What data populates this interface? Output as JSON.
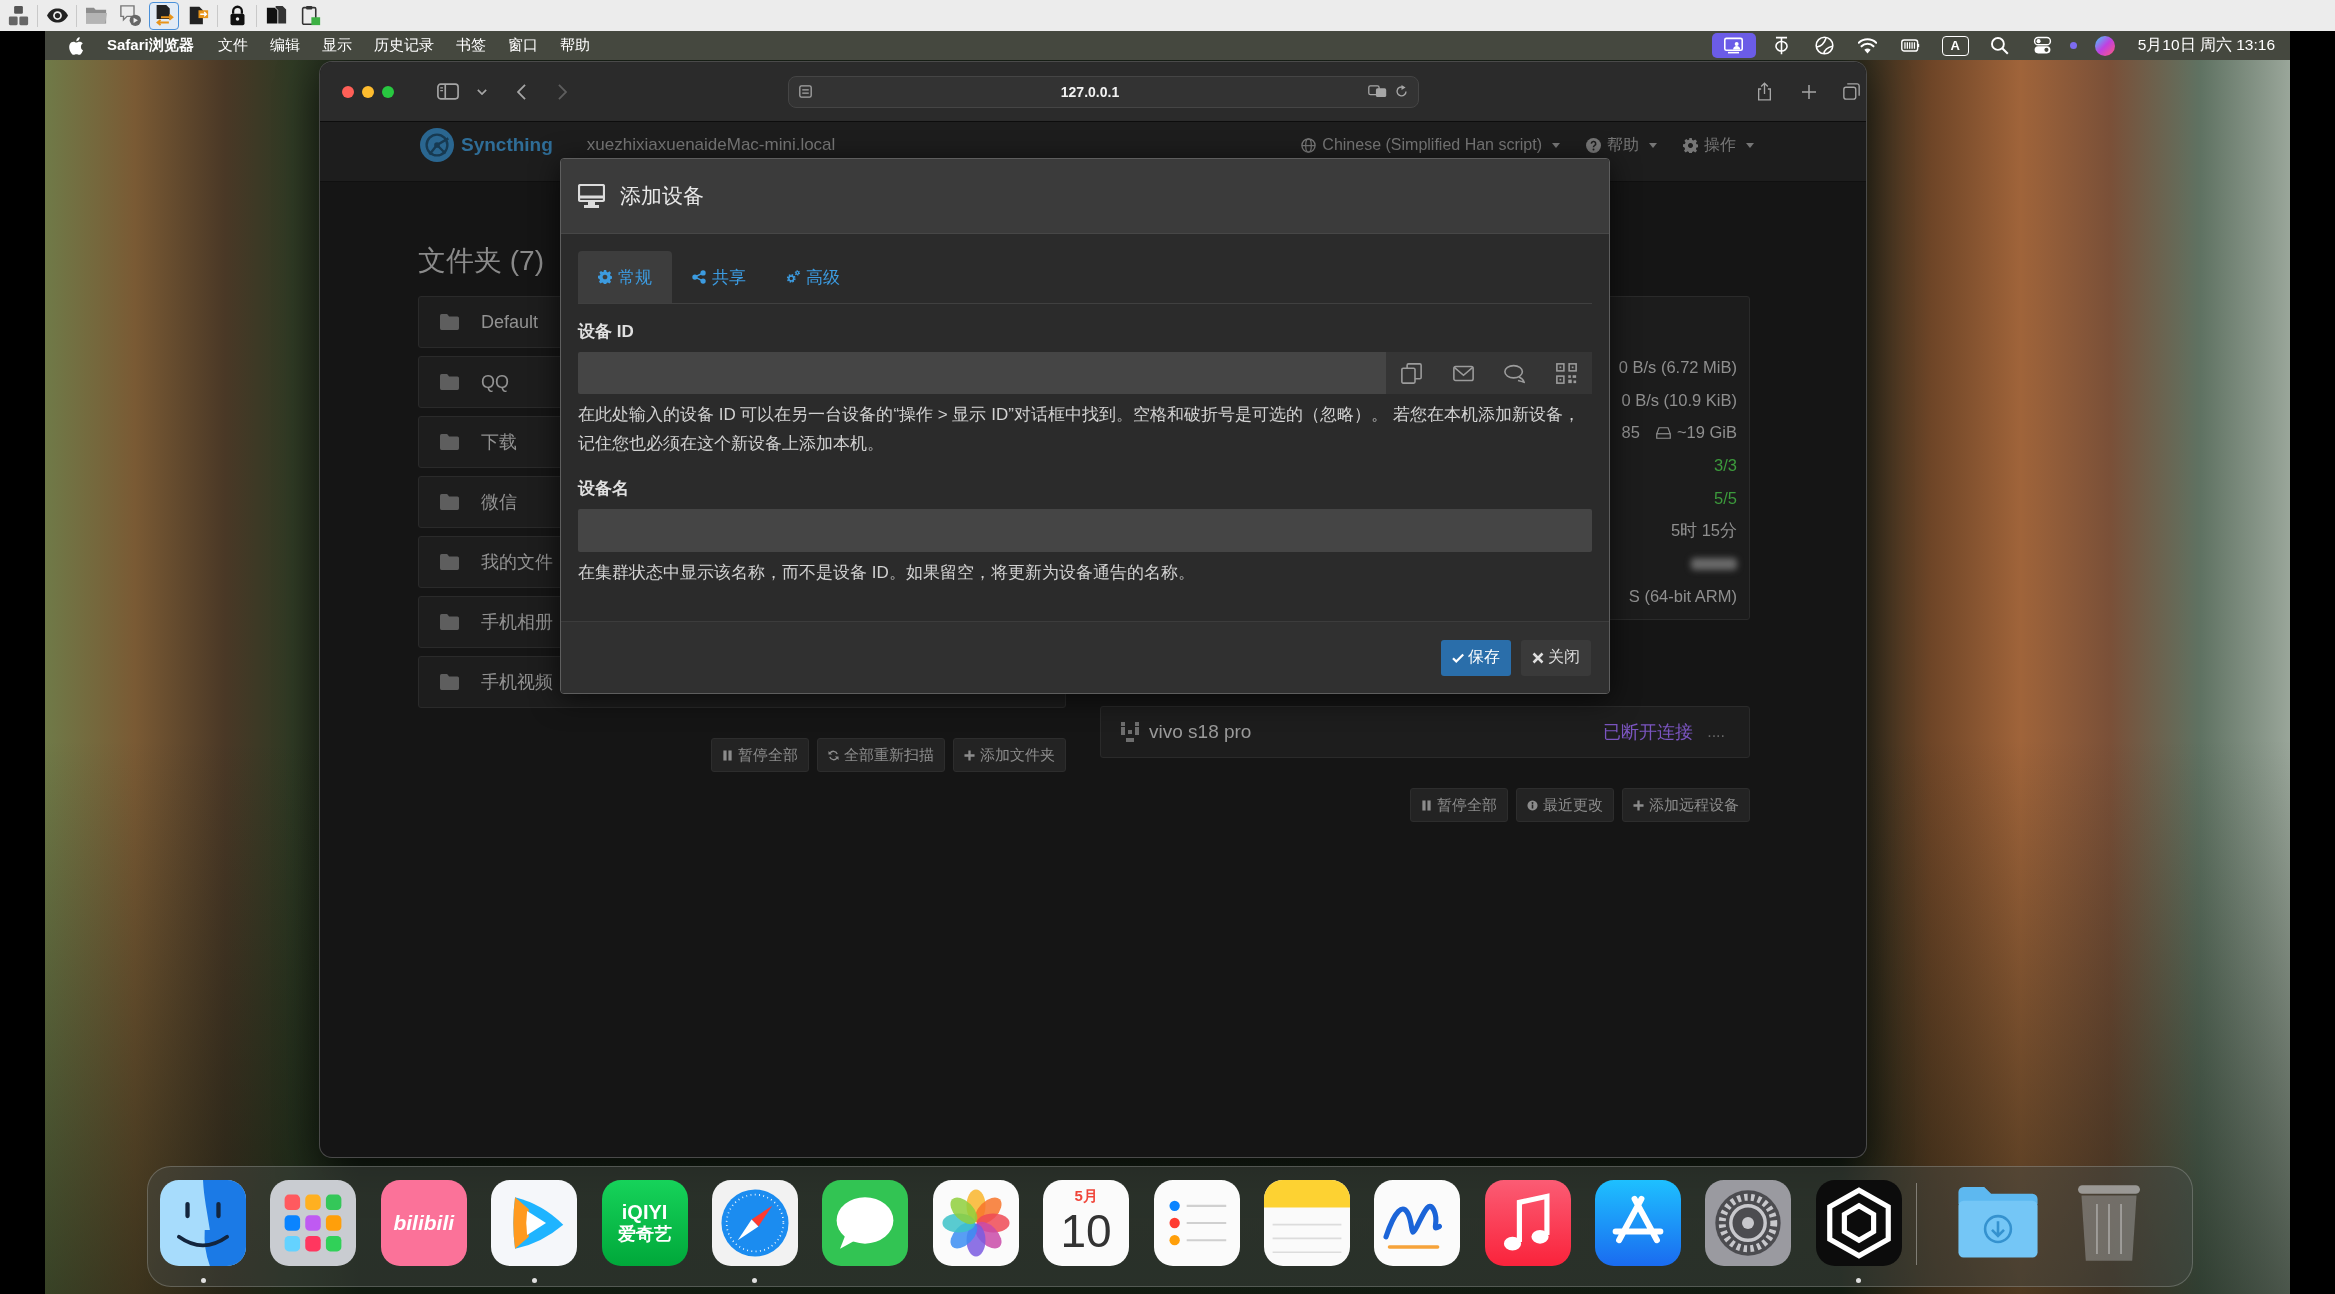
{
  "top_toolbar": {
    "groups": [
      {
        "items": [
          {
            "kind": "tiles",
            "selected": false
          }
        ]
      },
      {
        "items": [
          {
            "kind": "eye",
            "selected": false
          }
        ]
      },
      {
        "items": [
          {
            "kind": "folder",
            "selected": false
          },
          {
            "kind": "note",
            "selected": false
          },
          {
            "kind": "swap",
            "selected": true
          },
          {
            "kind": "swapalt",
            "selected": false
          }
        ]
      },
      {
        "items": [
          {
            "kind": "lock",
            "selected": false
          }
        ]
      },
      {
        "items": [
          {
            "kind": "copies",
            "selected": false
          },
          {
            "kind": "clipboard",
            "selected": false
          }
        ]
      }
    ]
  },
  "menu_bar": {
    "app_name": "Safari浏览器",
    "menus": [
      "文件",
      "编辑",
      "显示",
      "历史记录",
      "书签",
      "窗口",
      "帮助"
    ],
    "status_items": [
      {
        "kind": "screen",
        "active": true
      },
      {
        "kind": "tcircle",
        "active": false
      },
      {
        "kind": "globe",
        "active": false
      },
      {
        "kind": "wifi",
        "active": false
      },
      {
        "kind": "battery",
        "active": false
      },
      {
        "kind": "input",
        "label": "A",
        "active": false
      },
      {
        "kind": "search",
        "active": false
      },
      {
        "kind": "toggles",
        "active": false
      },
      {
        "kind": "dot",
        "active": false
      },
      {
        "kind": "orb",
        "active": false
      }
    ],
    "clock": "5月10日 周六 13:16"
  },
  "browser": {
    "address": "127.0.0.1"
  },
  "syncthing": {
    "brand": "Syncthing",
    "hostname": "xuezhixiaxuenaideMac-mini.local",
    "menus": [
      {
        "kind": "language",
        "label": "Chinese (Simplified Han script)"
      },
      {
        "kind": "help",
        "label": "帮助"
      },
      {
        "kind": "actions",
        "label": "操作"
      }
    ]
  },
  "folders": {
    "title": "文件夹 (7)",
    "items": [
      {
        "name": "Default"
      },
      {
        "name": "QQ"
      },
      {
        "name": "下载"
      },
      {
        "name": "微信"
      },
      {
        "name": "我的文件"
      },
      {
        "name": "手机相册"
      },
      {
        "name": "手机视频"
      }
    ],
    "buttons": [
      {
        "kind": "pause",
        "label": "暂停全部"
      },
      {
        "kind": "rescan",
        "label": "全部重新扫描"
      },
      {
        "kind": "add",
        "label": "添加文件夹"
      }
    ]
  },
  "this_device": {
    "rows": [
      {
        "kind": "text",
        "value": "0 B/s (6.72 MiB)"
      },
      {
        "kind": "text",
        "value": "0 B/s (10.9 KiB)"
      },
      {
        "kind": "disk",
        "value": "85",
        "extra": "~19 GiB"
      },
      {
        "kind": "count",
        "value": "3/3"
      },
      {
        "kind": "count",
        "value": "5/5"
      },
      {
        "kind": "text",
        "value": "5时 15分"
      },
      {
        "kind": "blurred"
      },
      {
        "kind": "text",
        "value": "S (64-bit ARM)"
      }
    ]
  },
  "remote_devices": {
    "items": [
      {
        "name": "vivo s18 pro",
        "status": "已断开连接",
        "detail": "...."
      }
    ],
    "buttons": [
      {
        "kind": "pause",
        "label": "暂停全部"
      },
      {
        "kind": "history",
        "label": "最近更改"
      },
      {
        "kind": "add",
        "label": "添加远程设备"
      }
    ]
  },
  "dialog": {
    "title": "添加设备",
    "tabs": [
      {
        "kind": "general",
        "label": "常规",
        "selected": true
      },
      {
        "kind": "sharing",
        "label": "共享",
        "selected": false
      },
      {
        "kind": "advanced",
        "label": "高级",
        "selected": false
      }
    ],
    "fields": [
      {
        "kind": "id",
        "label": "设备 ID",
        "help": "在此处输入的设备 ID 可以在另一台设备的“操作 > 显示 ID”对话框中找到。空格和破折号是可选的（忽略）。 若您在本机添加新设备，记住您也必须在这个新设备上添加本机。"
      },
      {
        "kind": "name",
        "label": "设备名",
        "help": "在集群状态中显示该名称，而不是设备 ID。如果留空，将更新为设备通告的名称。"
      }
    ],
    "buttons": [
      {
        "kind": "save",
        "label": "保存"
      },
      {
        "kind": "close",
        "label": "关闭"
      }
    ]
  },
  "dock": {
    "apps": [
      {
        "kind": "finder",
        "running": true
      },
      {
        "kind": "launchpad",
        "running": false
      },
      {
        "kind": "bilibili",
        "label": "bilibili",
        "running": false
      },
      {
        "kind": "video",
        "running": true
      },
      {
        "kind": "iqiyi",
        "label": "iQIYI",
        "sublabel": "爱奇艺",
        "running": false
      },
      {
        "kind": "safari",
        "running": true
      },
      {
        "kind": "messages",
        "running": false
      },
      {
        "kind": "photos",
        "running": false
      },
      {
        "kind": "calendar",
        "month": "5月",
        "day": "10",
        "running": false
      },
      {
        "kind": "reminders",
        "running": false
      },
      {
        "kind": "notes",
        "running": false
      },
      {
        "kind": "freeform",
        "running": false
      },
      {
        "kind": "music",
        "running": false
      },
      {
        "kind": "appstore",
        "running": false
      },
      {
        "kind": "settings",
        "running": false
      },
      {
        "kind": "hexagon",
        "running": true
      }
    ],
    "stacks": [
      {
        "kind": "downloads"
      },
      {
        "kind": "trash"
      }
    ]
  }
}
